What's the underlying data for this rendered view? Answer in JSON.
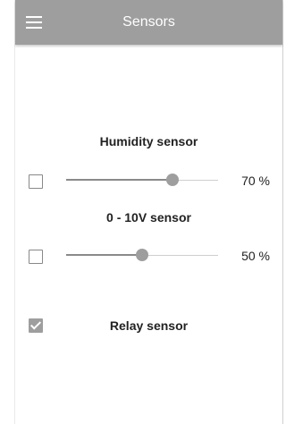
{
  "app": {
    "title": "Sensors"
  },
  "sensors": [
    {
      "label": "Humidity sensor",
      "checked": false,
      "level": 0.7,
      "value_text": "70 %"
    },
    {
      "label": "0 - 10V sensor",
      "checked": false,
      "level": 0.5,
      "value_text": "50 %"
    }
  ],
  "relay": {
    "label": "Relay sensor",
    "checked": true
  },
  "colors": {
    "appbar": "#9e9e9e",
    "accent": "#9e9e9e"
  }
}
